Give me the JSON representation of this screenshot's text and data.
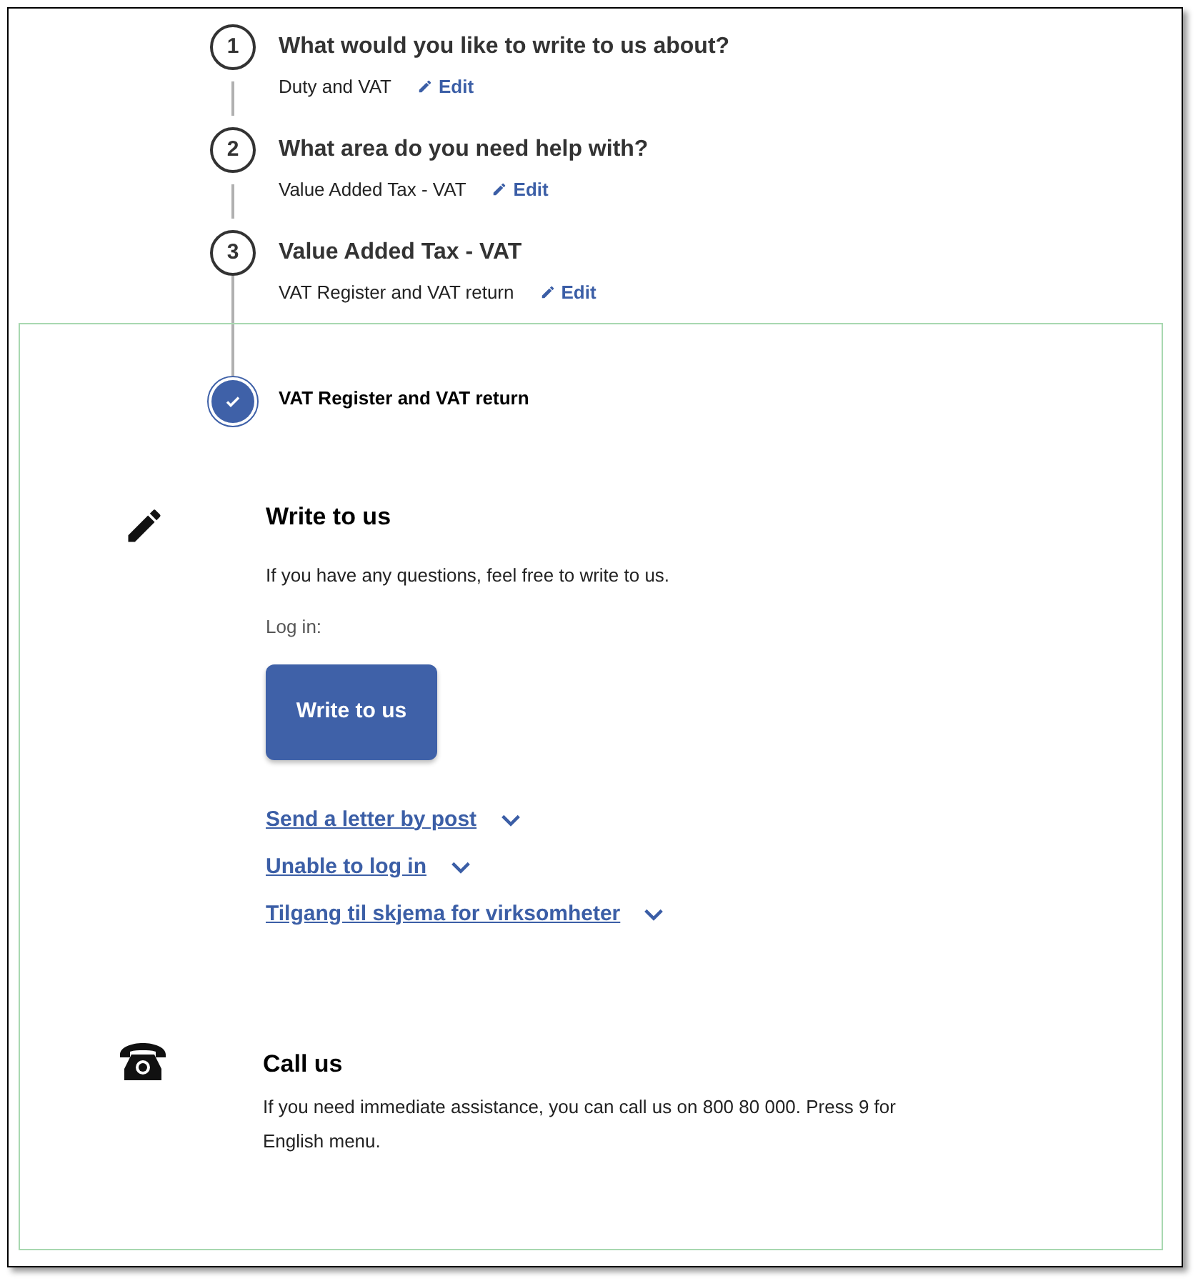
{
  "steps": [
    {
      "number": "1",
      "title": "What would you like to write to us about?",
      "answer": "Duty and VAT",
      "edit_label": "Edit"
    },
    {
      "number": "2",
      "title": "What area do you need help with?",
      "answer": "Value Added Tax - VAT",
      "edit_label": "Edit"
    },
    {
      "number": "3",
      "title": "Value Added Tax - VAT",
      "answer": "VAT Register and VAT return",
      "edit_label": "Edit"
    }
  ],
  "current_step": {
    "title": "VAT Register and VAT return",
    "completed": true
  },
  "contact_methods": [
    {
      "kind": "write",
      "heading": "Write to us",
      "description": "If you have any questions, feel free to write to us.",
      "login_label": "Log in:",
      "button": "Write to us",
      "links": [
        {
          "label": "Send a letter by post",
          "expanded": false
        },
        {
          "label": "Unable to log in",
          "expanded": false
        },
        {
          "label": "Tilgang til skjema for virksomheter",
          "expanded": false
        }
      ]
    },
    {
      "kind": "call",
      "heading": "Call us",
      "description": "If you need immediate assistance, you can call us on 800 80 000. Press 9 for English menu."
    }
  ]
}
